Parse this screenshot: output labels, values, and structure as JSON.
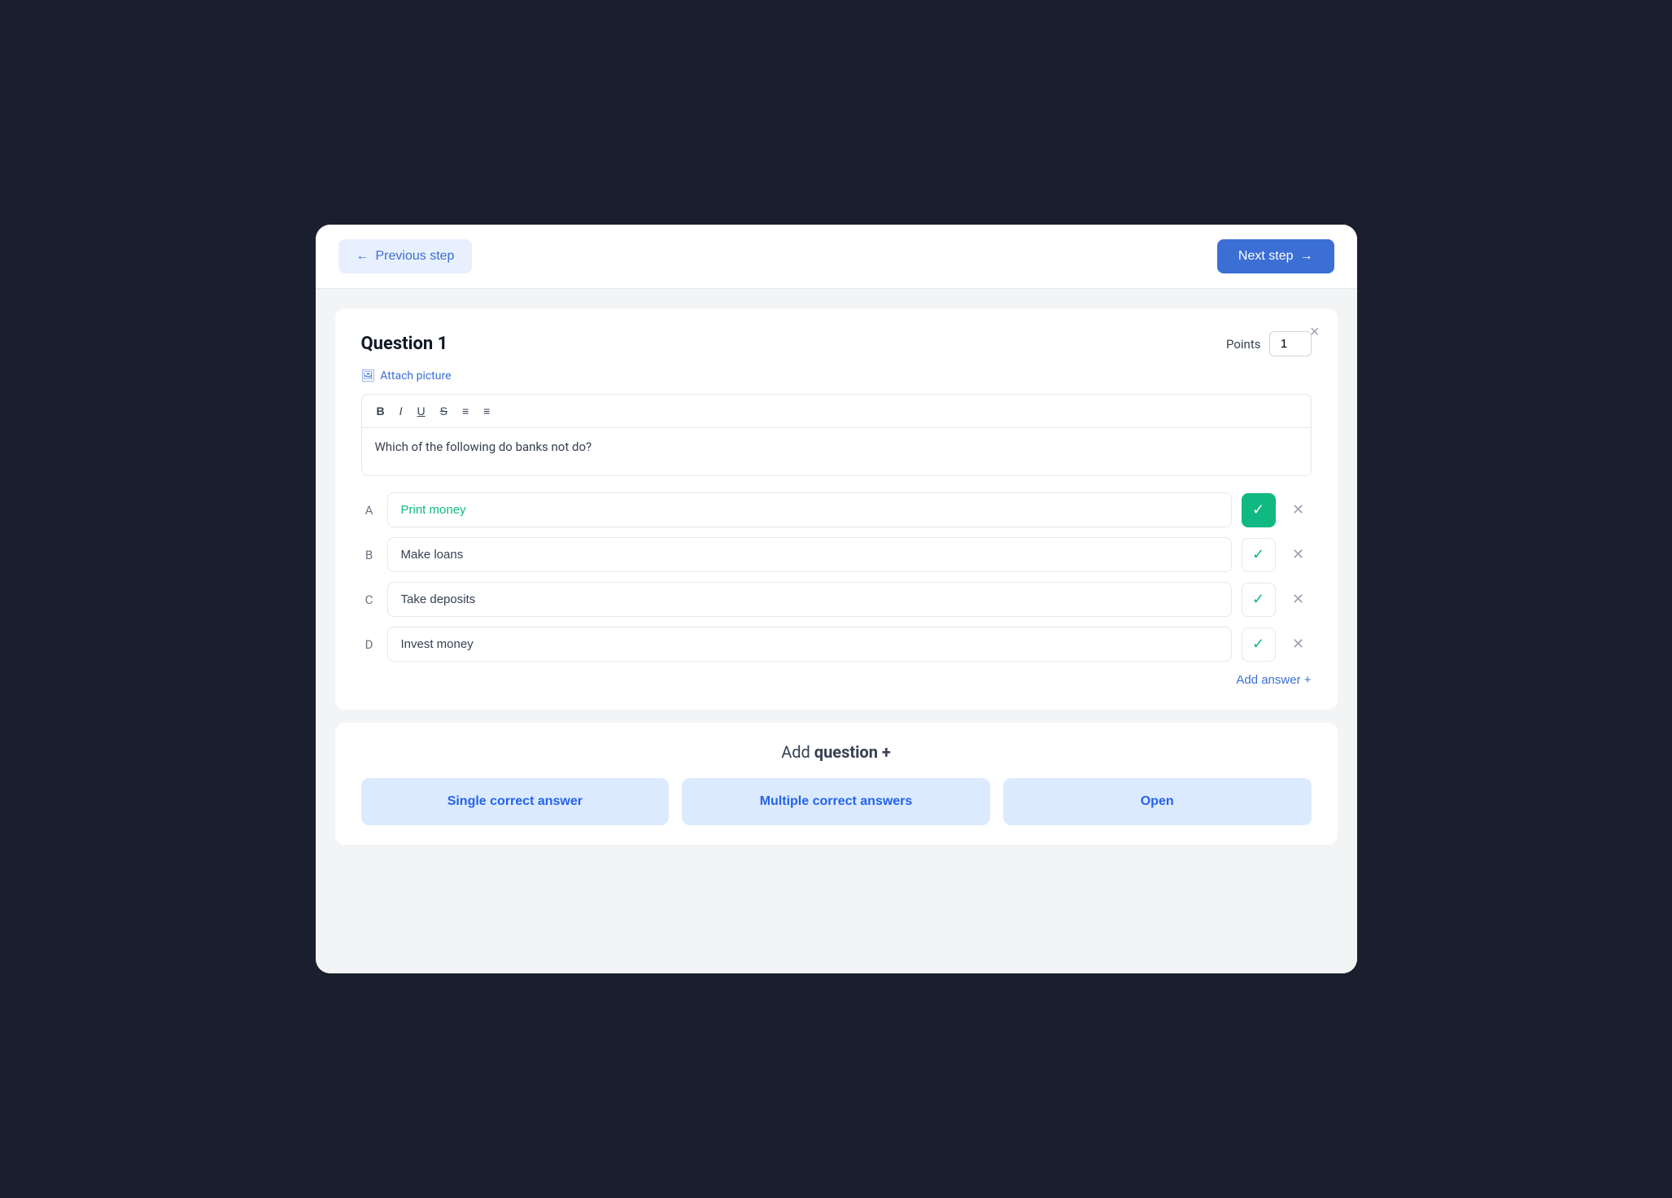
{
  "navigation": {
    "prev_label": "Previous step",
    "next_label": "Next step"
  },
  "question_card": {
    "title": "Question 1",
    "points_label": "Points",
    "points_value": "1",
    "close_icon": "×",
    "attach_picture_label": "Attach picture",
    "toolbar": {
      "bold": "B",
      "italic": "I",
      "underline": "U",
      "strikethrough": "S",
      "ordered_list": "≡",
      "unordered_list": "≡"
    },
    "question_text": "Which of the following do banks not do?",
    "answers": [
      {
        "letter": "A",
        "text": "Print money",
        "correct": true
      },
      {
        "letter": "B",
        "text": "Make loans",
        "correct": false
      },
      {
        "letter": "C",
        "text": "Take deposits",
        "correct": false
      },
      {
        "letter": "D",
        "text": "Invest money",
        "correct": false
      }
    ],
    "add_answer_label": "Add answer +"
  },
  "add_question": {
    "title_prefix": "Add ",
    "title_bold": "question +",
    "buttons": [
      {
        "label": "Single correct answer"
      },
      {
        "label": "Multiple correct answers"
      },
      {
        "label": "Open"
      }
    ]
  }
}
